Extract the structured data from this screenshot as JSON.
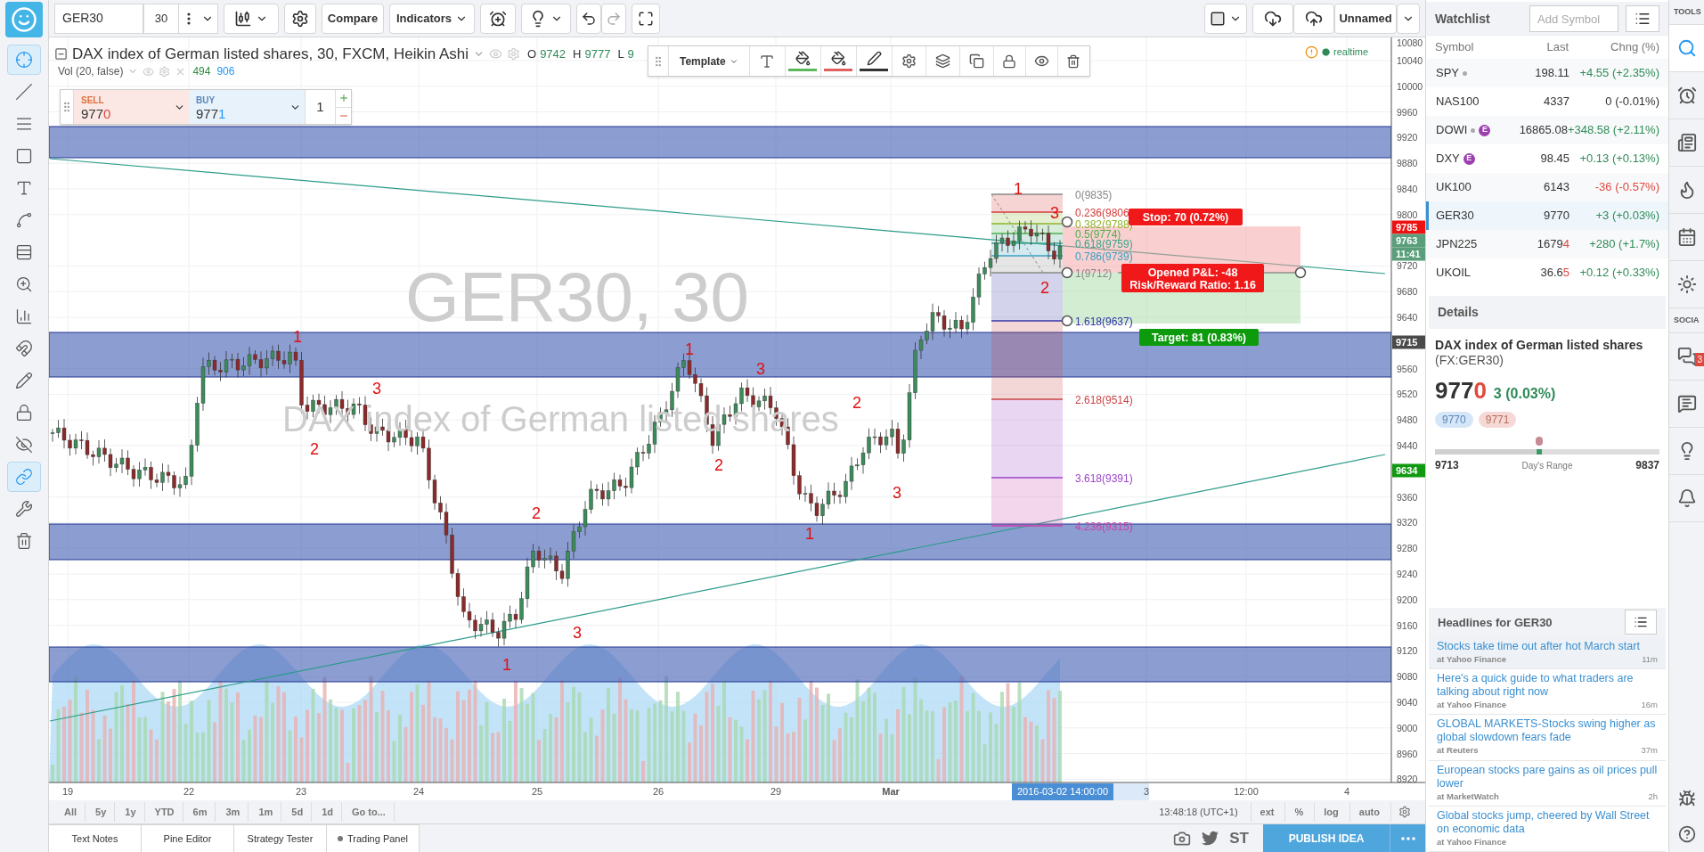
{
  "top_toolbar": {
    "symbol": "GER30",
    "interval": "30",
    "buttons": [
      "Compare",
      "Indicators"
    ],
    "layout_name": "Unnamed"
  },
  "left_toolbar": {
    "tools": [
      {
        "kind": "crosshair",
        "selected": true
      },
      {
        "kind": "trendline",
        "selected": false
      },
      {
        "kind": "lines",
        "selected": false
      },
      {
        "kind": "rectangle",
        "selected": false
      },
      {
        "kind": "text",
        "selected": false
      },
      {
        "kind": "pattern",
        "selected": false
      },
      {
        "kind": "fib",
        "selected": false
      },
      {
        "kind": "zoom",
        "selected": false
      },
      {
        "kind": "measure",
        "selected": false
      },
      {
        "kind": "magnet",
        "selected": false
      },
      {
        "kind": "pencil",
        "selected": false
      },
      {
        "kind": "lock",
        "selected": false
      },
      {
        "kind": "hide",
        "selected": false
      },
      {
        "kind": "link",
        "selected": true
      },
      {
        "kind": "wrench",
        "selected": false
      },
      {
        "kind": "trash",
        "selected": false
      }
    ]
  },
  "chart": {
    "title": "DAX index of German listed shares, 30, FXCM, Heikin Ashi",
    "ohlc": [
      {
        "label": "O",
        "value": "9742"
      },
      {
        "label": "H",
        "value": "9777"
      },
      {
        "label": "L",
        "value": "9"
      }
    ],
    "volume_legend": {
      "label": "Vol (20, false)",
      "values": [
        {
          "text": "494",
          "color": "#2e8b3e"
        },
        {
          "text": "906",
          "color": "#2196f3"
        }
      ]
    },
    "status": "realtime",
    "watermark_symbol": "GER30, 30",
    "watermark_name": "DAX index of German listed shares",
    "trade_panel": {
      "sell_label": "SELL",
      "sell_price": "977",
      "sell_tick": "0",
      "buy_label": "BUY",
      "buy_price": "977",
      "buy_tick": "1",
      "quantity": "1"
    },
    "drawing_toolbar": {
      "template": "Template",
      "swatches": [
        {
          "color": "#5cb85c"
        },
        {
          "color": "#e06060"
        },
        {
          "color": "#333333"
        }
      ]
    },
    "wave_labels": [
      "1",
      "2",
      "3",
      "2",
      "1",
      "3",
      "1",
      "2",
      "3",
      "1",
      "2",
      "3",
      "1",
      "2",
      "3"
    ],
    "fib_levels": [
      {
        "label": "0(9835)",
        "color": "#888888"
      },
      {
        "label": "0.236(9806",
        "color": "#d63c3c"
      },
      {
        "label": "0.382(9788)",
        "color": "#8fb52c"
      },
      {
        "label": "0.5(9774)",
        "color": "#4caf50"
      },
      {
        "label": "0.618(9759)",
        "color": "#3aa58a"
      },
      {
        "label": "0.786(9739)",
        "color": "#3a9fc0"
      },
      {
        "label": "1(9712)",
        "color": "#888888"
      },
      {
        "label": "1.618(9637)",
        "color": "#3535a8"
      },
      {
        "label": "2.618(9514)",
        "color": "#c84444"
      },
      {
        "label": "3.618(9391)",
        "color": "#9b45c9"
      },
      {
        "label": "4.236(9315)",
        "color": "#c844a8"
      }
    ],
    "position": {
      "stop": "Stop: 70 (0.72%)",
      "pnl": "Opened P&L: -48",
      "ratio": "Risk/Reward Ratio: 1.16",
      "target": "Target: 81 (0.83%)"
    },
    "price_axis": [
      "10080",
      "10040",
      "10000",
      "9960",
      "9920",
      "9880",
      "9840",
      "9800",
      "9720",
      "9680",
      "9640",
      "9560",
      "9520",
      "9480",
      "9440",
      "9360",
      "9320",
      "9280",
      "9240",
      "9200",
      "9160",
      "9120",
      "9080",
      "9040",
      "9000",
      "8960",
      "8920"
    ],
    "price_tags": [
      {
        "text": "9785",
        "color": "#ee1111"
      },
      {
        "text": "9763",
        "color": "#5a9e7b"
      },
      {
        "text": "11:41",
        "color": "#5a9e7b"
      },
      {
        "text": "9715",
        "color": "#4a4a4a"
      },
      {
        "text": "9634",
        "color": "#119911"
      }
    ],
    "time_axis": [
      {
        "text": "19",
        "bold": false
      },
      {
        "text": "22",
        "bold": false
      },
      {
        "text": "23",
        "bold": false
      },
      {
        "text": "24",
        "bold": false
      },
      {
        "text": "25",
        "bold": false
      },
      {
        "text": "26",
        "bold": false
      },
      {
        "text": "29",
        "bold": false
      },
      {
        "text": "Mar",
        "bold": true
      },
      {
        "text": "3",
        "bold": false
      },
      {
        "text": "12:00",
        "bold": false
      },
      {
        "text": "4",
        "bold": false
      }
    ],
    "cursor_time": "2016-03-02 14:00:00"
  },
  "range_bar": {
    "ranges": [
      "All",
      "5y",
      "1y",
      "YTD",
      "6m",
      "3m",
      "1m",
      "5d",
      "1d",
      "Go to..."
    ],
    "clock": "13:48:18 (UTC+1)",
    "options": [
      "ext",
      "%",
      "log",
      "auto"
    ]
  },
  "bottom_bar": {
    "tabs": [
      {
        "label": "Text Notes",
        "dot": false
      },
      {
        "label": "Pine Editor",
        "dot": false
      },
      {
        "label": "Strategy Tester",
        "dot": false
      },
      {
        "label": "Trading Panel",
        "dot": true
      }
    ],
    "st": "ST",
    "publish": "PUBLISH IDEA"
  },
  "watchlist": {
    "title": "Watchlist",
    "placeholder": "Add Symbol",
    "columns": [
      "Symbol",
      "Last",
      "Chng (%)"
    ],
    "rows": [
      {
        "symbol": "SPY",
        "dot": true,
        "last": "198.11",
        "change": "+4.55 (+2.35%)",
        "color": "#2e8b57",
        "selected": false
      },
      {
        "symbol": "NAS100",
        "dot": false,
        "last": "4337",
        "change": "0 (-0.01%)",
        "color": "#333333",
        "selected": false
      },
      {
        "symbol": "DOWI",
        "dot": true,
        "badge": "E",
        "last": "16865.08",
        "change": "+348.58 (+2.11%)",
        "color": "#2e8b57",
        "selected": false
      },
      {
        "symbol": "DXY",
        "dot": false,
        "badge": "E",
        "last": "98.45",
        "change": "+0.13 (+0.13%)",
        "color": "#2e8b57",
        "selected": false
      },
      {
        "symbol": "UK100",
        "dot": false,
        "last": "6143",
        "change": "-36 (-0.57%)",
        "color": "#e0483e",
        "selected": false
      },
      {
        "symbol": "GER30",
        "dot": false,
        "last": "9770",
        "change": "+3 (+0.03%)",
        "color": "#2e8b57",
        "selected": true
      },
      {
        "symbol": "JPN225",
        "dot": false,
        "last": "1679",
        "last_tick": "4",
        "change": "+280 (+1.7%)",
        "color": "#2e8b57",
        "selected": false
      },
      {
        "symbol": "UKOIL",
        "dot": false,
        "last": "36.6",
        "last_tick": "5",
        "change": "+0.12 (+0.33%)",
        "color": "#2e8b57",
        "selected": false
      }
    ]
  },
  "details": {
    "title": "Details",
    "name": "DAX index of German listed shares",
    "ticker": "(FX:GER30)",
    "price": "977",
    "price_tick": "0",
    "change": "3 (0.03%)",
    "bid": "9770",
    "ask": "9771",
    "range_low": "9713",
    "range_high": "9837",
    "range_label": "Day's Range",
    "level": 0.45
  },
  "headlines": {
    "title": "Headlines for GER30",
    "items": [
      {
        "title": "Stocks take time out after hot March start",
        "source": "at Yahoo Finance",
        "age": "11m",
        "selected": true
      },
      {
        "title": "Here's a quick guide to what traders are talking about right now",
        "source": "at Yahoo Finance",
        "age": "16m",
        "selected": false
      },
      {
        "title": "GLOBAL MARKETS-Stocks swing higher as global slowdown fears fade",
        "source": "at Reuters",
        "age": "37m",
        "selected": false
      },
      {
        "title": "European stocks pare gains as oil prices pull lower",
        "source": "at MarketWatch",
        "age": "2h",
        "selected": false
      },
      {
        "title": "Global stocks jump, cheered by Wall Street on economic data",
        "source": "at Yahoo Finance",
        "selected": false
      }
    ]
  },
  "side_panel": {
    "sections": [
      {
        "label": "TOOLS",
        "tools": [
          {
            "kind": "search",
            "selected": true
          },
          {
            "kind": "alarm",
            "selected": false
          },
          {
            "kind": "list",
            "selected": false
          },
          {
            "kind": "flame",
            "selected": false
          },
          {
            "kind": "calendar",
            "selected": false
          },
          {
            "kind": "sun",
            "selected": false
          }
        ]
      },
      {
        "label": "SOCIA",
        "tools": [
          {
            "kind": "chat",
            "selected": false,
            "badge": "3"
          },
          {
            "kind": "messages",
            "selected": false
          },
          {
            "kind": "bulb",
            "selected": false
          },
          {
            "kind": "bell",
            "selected": false
          }
        ]
      }
    ],
    "bottom_tools": [
      {
        "kind": "bug",
        "selected": false
      },
      {
        "kind": "help",
        "selected": false
      }
    ]
  }
}
